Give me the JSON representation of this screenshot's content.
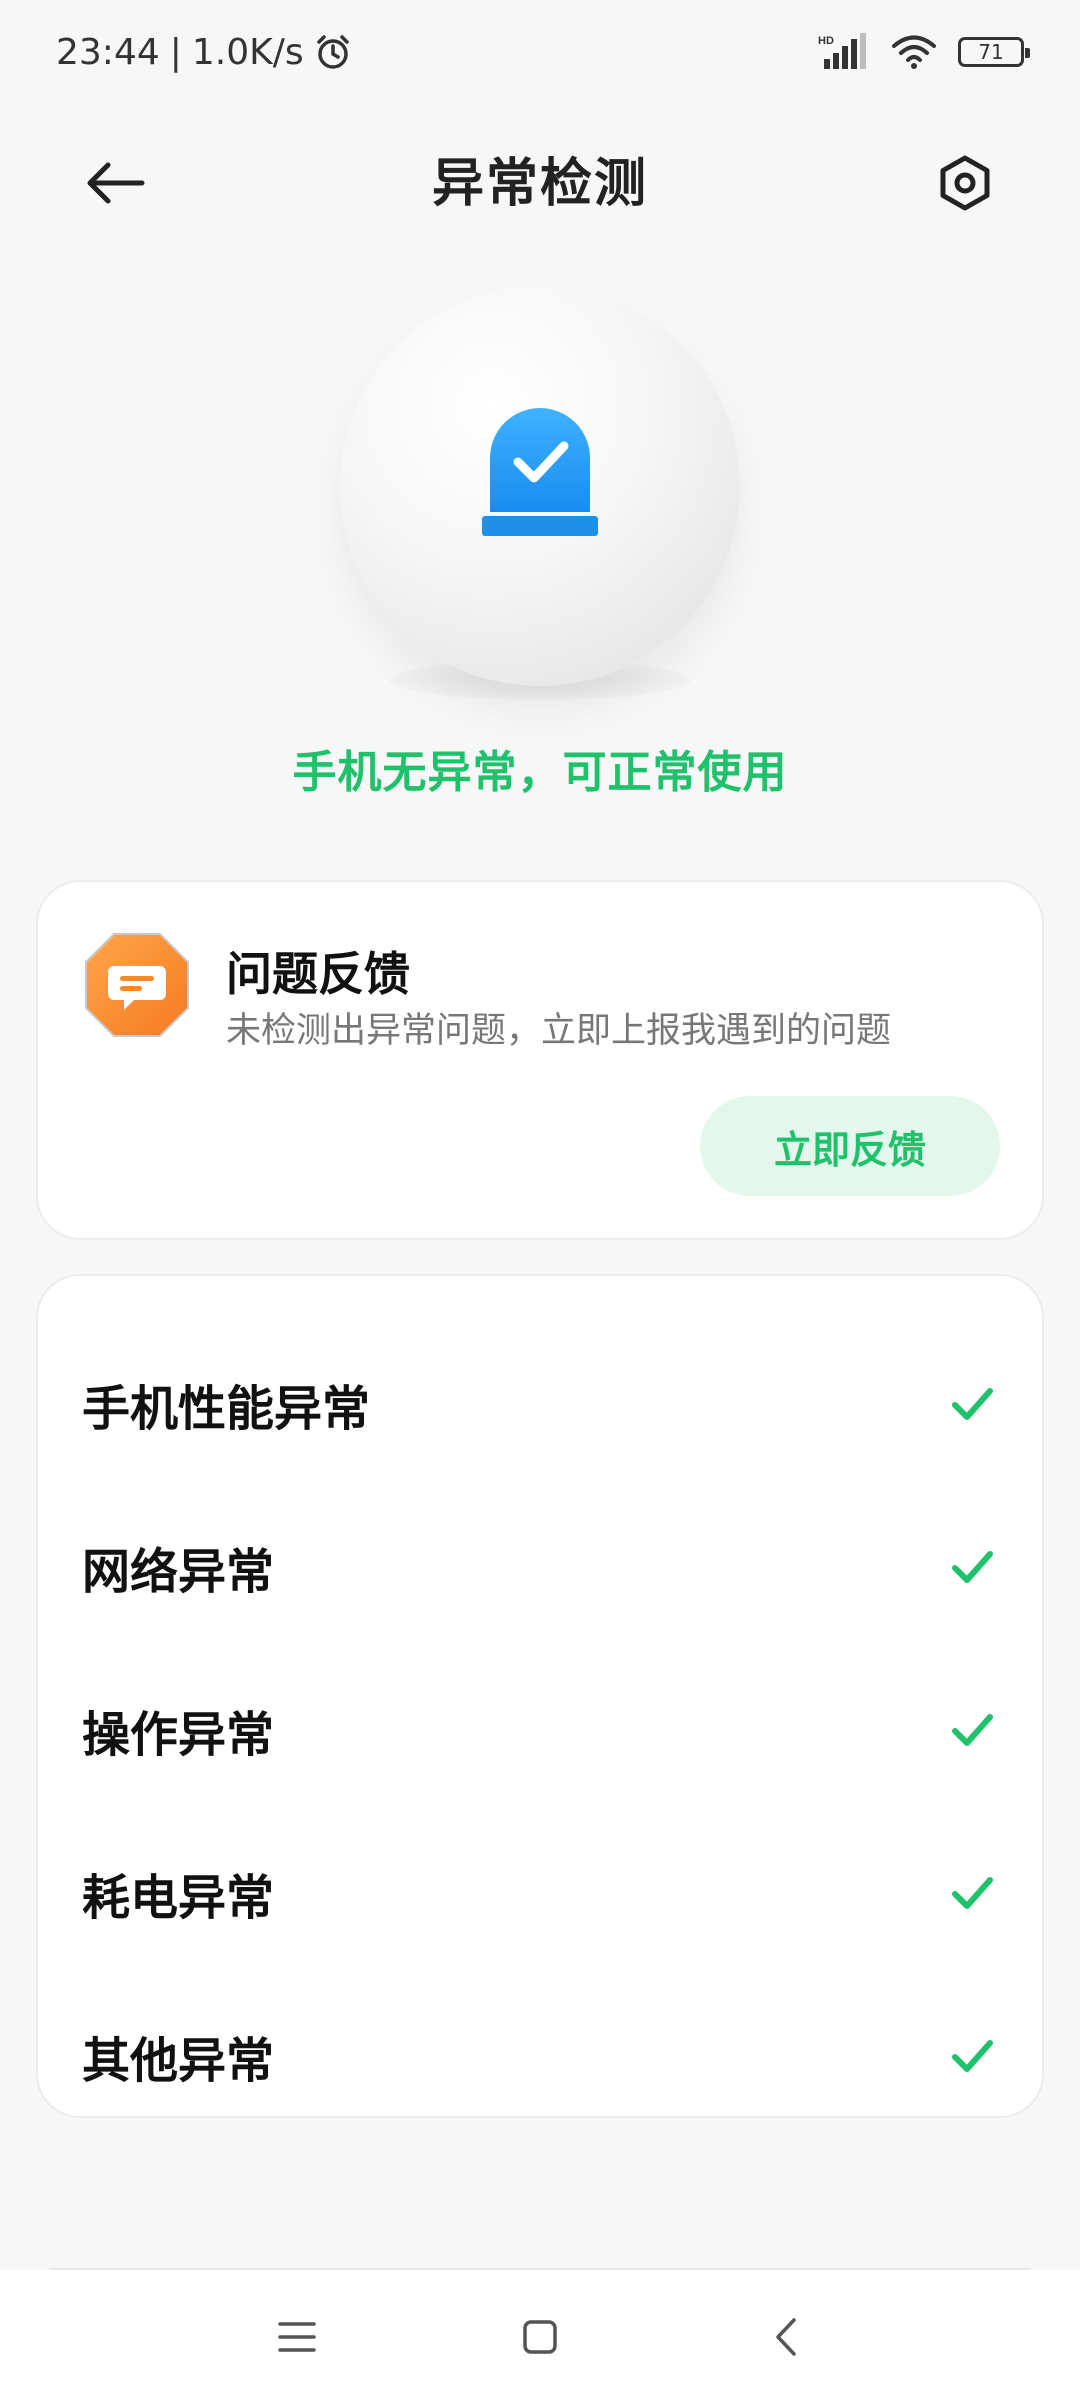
{
  "status_bar": {
    "time": "23:44",
    "network_speed": "1.0K/s",
    "battery_level": "71"
  },
  "header": {
    "title": "异常检测"
  },
  "hero": {
    "message": "手机无异常，可正常使用",
    "accent_color": "#1fc16b",
    "icon": "shield-check-icon"
  },
  "feedback": {
    "title": "问题反馈",
    "description": "未检测出异常问题，立即上报我遇到的问题",
    "button_label": "立即反馈"
  },
  "checks": {
    "items": [
      {
        "label": "手机性能异常",
        "status": "ok"
      },
      {
        "label": "网络异常",
        "status": "ok"
      },
      {
        "label": "操作异常",
        "status": "ok"
      },
      {
        "label": "耗电异常",
        "status": "ok"
      },
      {
        "label": "其他异常",
        "status": "ok"
      }
    ]
  }
}
